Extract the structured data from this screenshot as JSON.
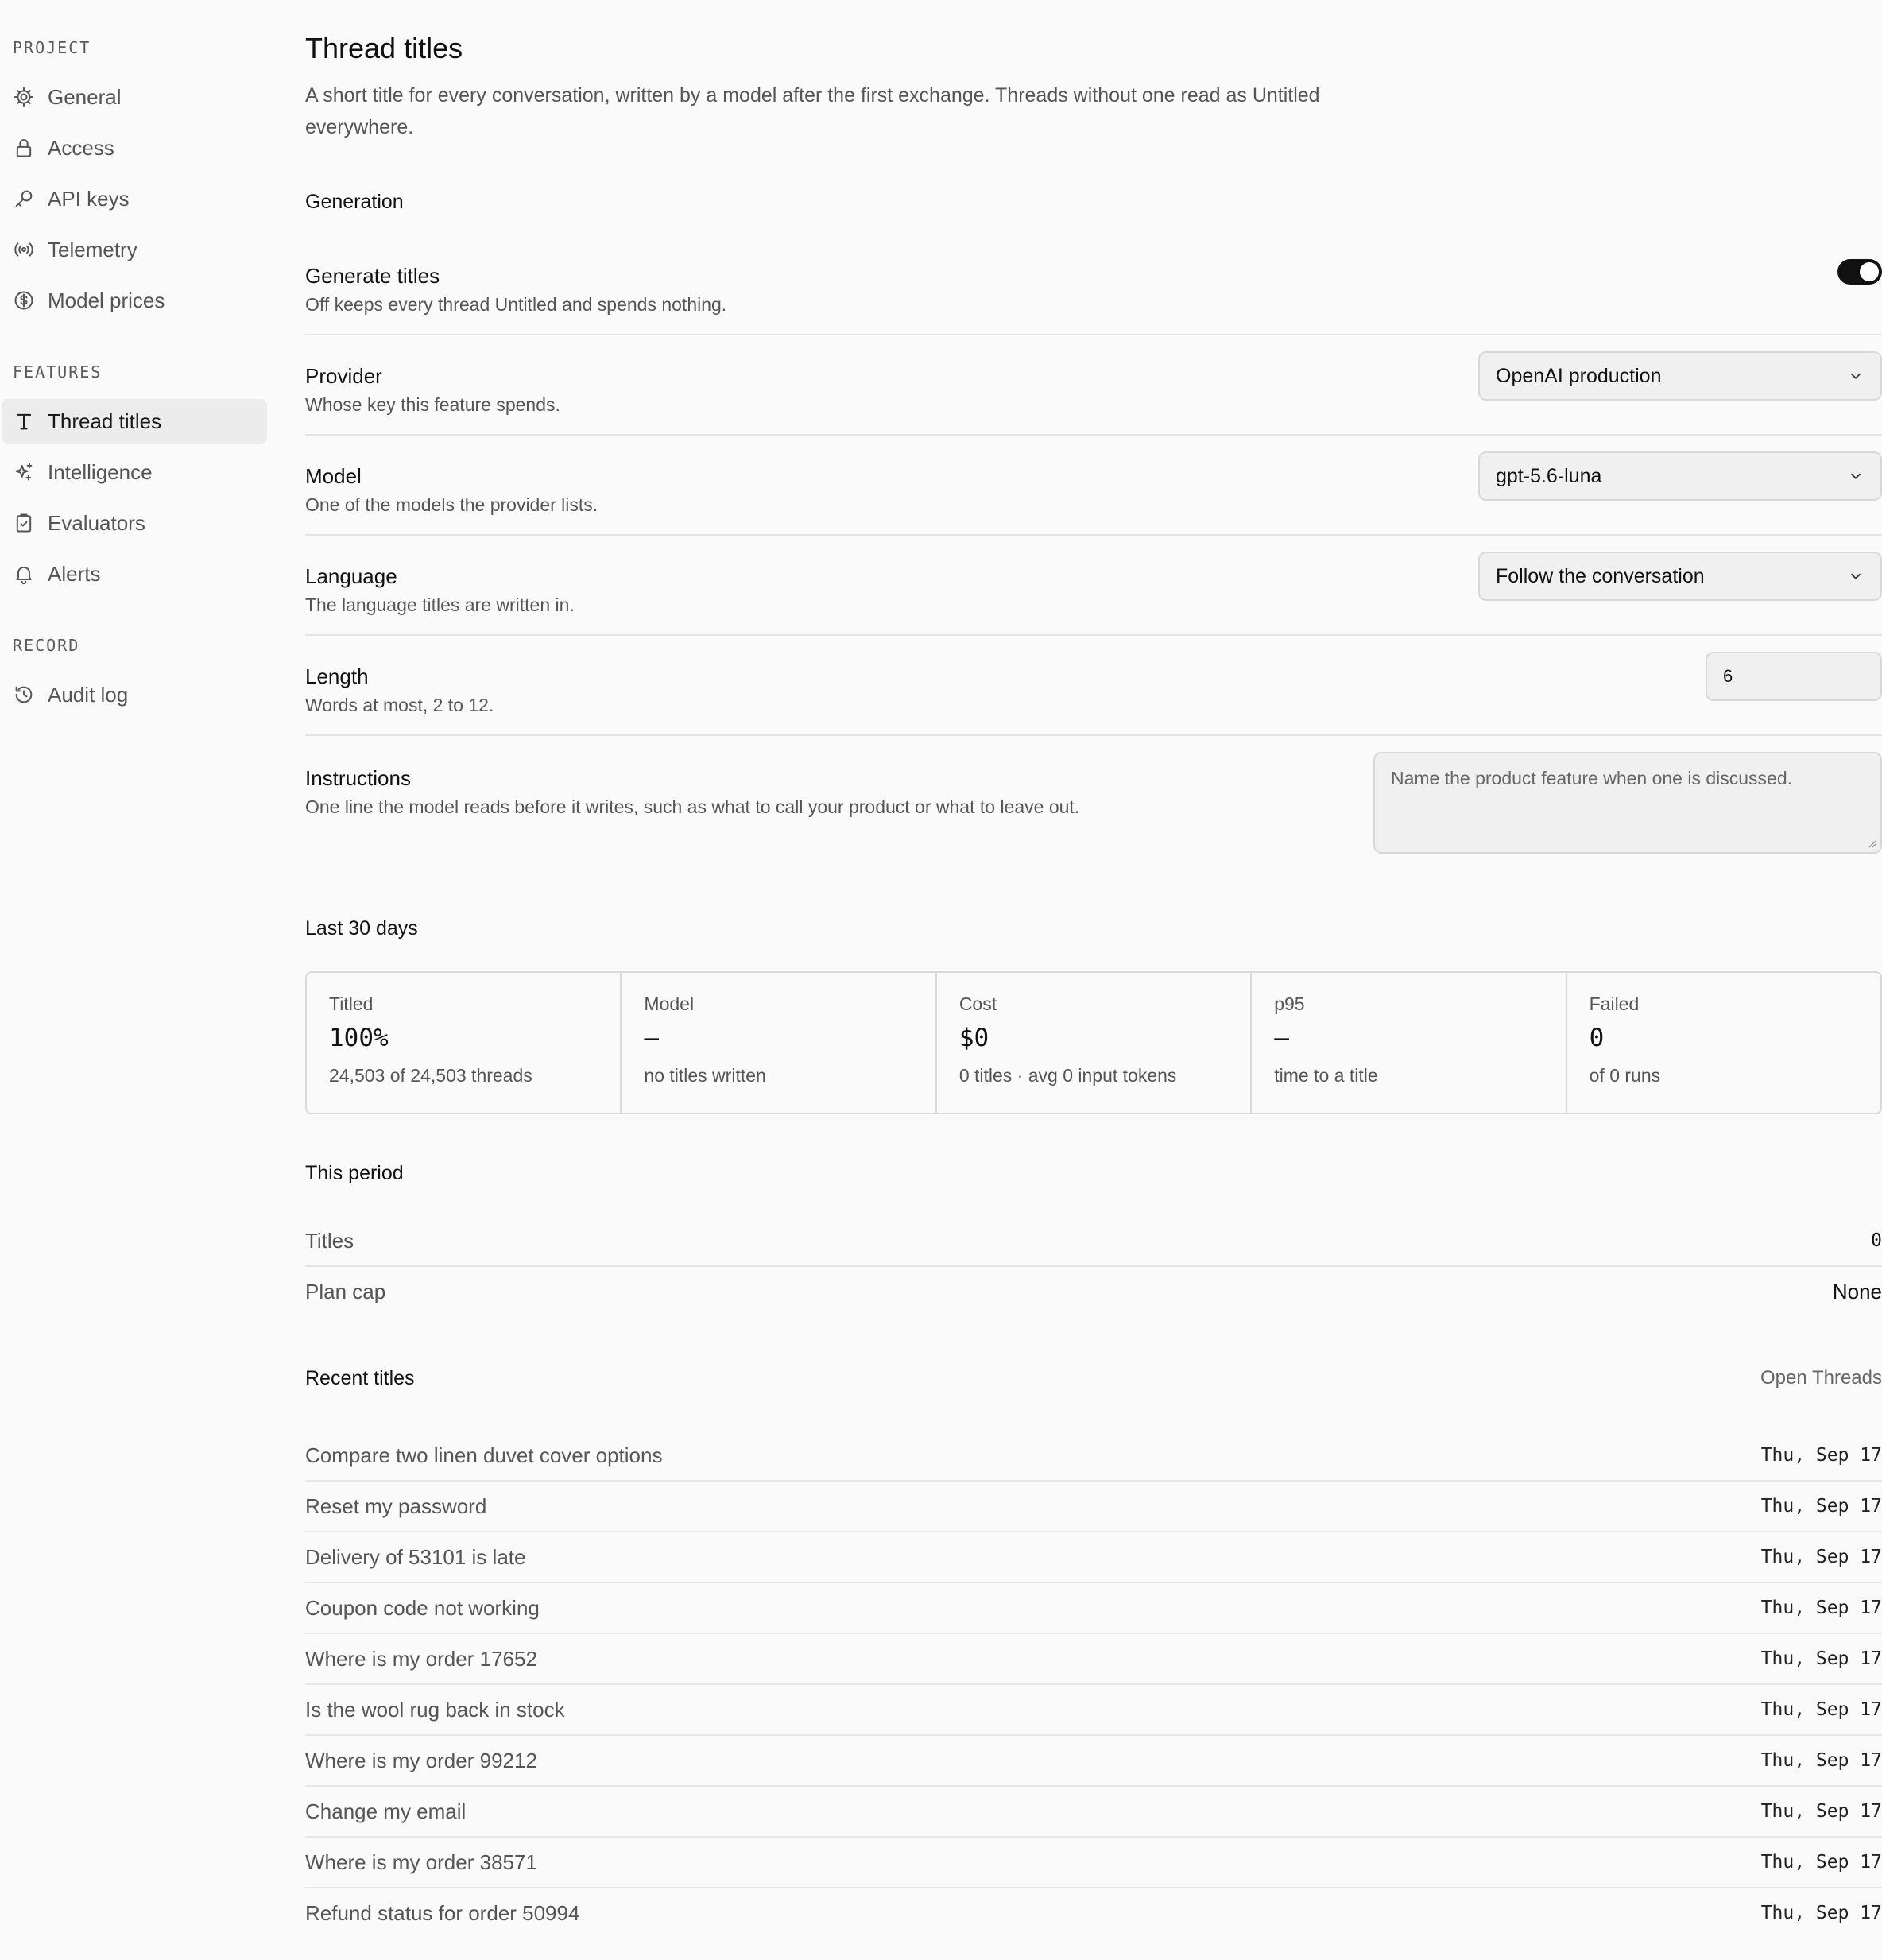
{
  "sidebar": {
    "sections": [
      {
        "label": "PROJECT",
        "items": [
          {
            "label": "General",
            "icon": "gear-icon"
          },
          {
            "label": "Access",
            "icon": "lock-icon"
          },
          {
            "label": "API keys",
            "icon": "key-icon"
          },
          {
            "label": "Telemetry",
            "icon": "broadcast-icon"
          },
          {
            "label": "Model prices",
            "icon": "dollar-icon"
          }
        ]
      },
      {
        "label": "FEATURES",
        "items": [
          {
            "label": "Thread titles",
            "icon": "text-t-icon",
            "active": true
          },
          {
            "label": "Intelligence",
            "icon": "sparkle-icon"
          },
          {
            "label": "Evaluators",
            "icon": "clipboard-check-icon"
          },
          {
            "label": "Alerts",
            "icon": "bell-icon"
          }
        ]
      },
      {
        "label": "RECORD",
        "items": [
          {
            "label": "Audit log",
            "icon": "history-icon"
          }
        ]
      }
    ]
  },
  "page": {
    "title": "Thread titles",
    "description": "A short title for every conversation, written by a model after the first exchange. Threads without one read as Untitled everywhere."
  },
  "generation": {
    "heading": "Generation",
    "generate": {
      "title": "Generate titles",
      "desc": "Off keeps every thread Untitled and spends nothing.",
      "enabled": true
    },
    "provider": {
      "title": "Provider",
      "desc": "Whose key this feature spends.",
      "value": "OpenAI production"
    },
    "model": {
      "title": "Model",
      "desc": "One of the models the provider lists.",
      "value": "gpt-5.6-luna"
    },
    "language": {
      "title": "Language",
      "desc": "The language titles are written in.",
      "value": "Follow the conversation"
    },
    "length": {
      "title": "Length",
      "desc": "Words at most, 2 to 12.",
      "value": "6"
    },
    "instructions": {
      "title": "Instructions",
      "desc": "One line the model reads before it writes, such as what to call your product or what to leave out.",
      "placeholder": "Name the product feature when one is discussed."
    }
  },
  "last30": {
    "heading": "Last 30 days",
    "stats": [
      {
        "label": "Titled",
        "value": "100%",
        "sub": "24,503 of 24,503 threads"
      },
      {
        "label": "Model",
        "value": "—",
        "sub": "no titles written"
      },
      {
        "label": "Cost",
        "value": "$0",
        "sub": "0 titles · avg 0 input tokens"
      },
      {
        "label": "p95",
        "value": "—",
        "sub": "time to a title"
      },
      {
        "label": "Failed",
        "value": "0",
        "sub": "of 0 runs"
      }
    ]
  },
  "period": {
    "heading": "This period",
    "rows": [
      {
        "label": "Titles",
        "value": "0"
      },
      {
        "label": "Plan cap",
        "value": "None"
      }
    ]
  },
  "recent": {
    "heading": "Recent titles",
    "link": "Open Threads",
    "items": [
      {
        "title": "Compare two linen duvet cover options",
        "date": "Thu, Sep 17"
      },
      {
        "title": "Reset my password",
        "date": "Thu, Sep 17"
      },
      {
        "title": "Delivery of 53101 is late",
        "date": "Thu, Sep 17"
      },
      {
        "title": "Coupon code not working",
        "date": "Thu, Sep 17"
      },
      {
        "title": "Where is my order 17652",
        "date": "Thu, Sep 17"
      },
      {
        "title": "Is the wool rug back in stock",
        "date": "Thu, Sep 17"
      },
      {
        "title": "Where is my order 99212",
        "date": "Thu, Sep 17"
      },
      {
        "title": "Change my email",
        "date": "Thu, Sep 17"
      },
      {
        "title": "Where is my order 38571",
        "date": "Thu, Sep 17"
      },
      {
        "title": "Refund status for order 50994",
        "date": "Thu, Sep 17"
      }
    ]
  }
}
